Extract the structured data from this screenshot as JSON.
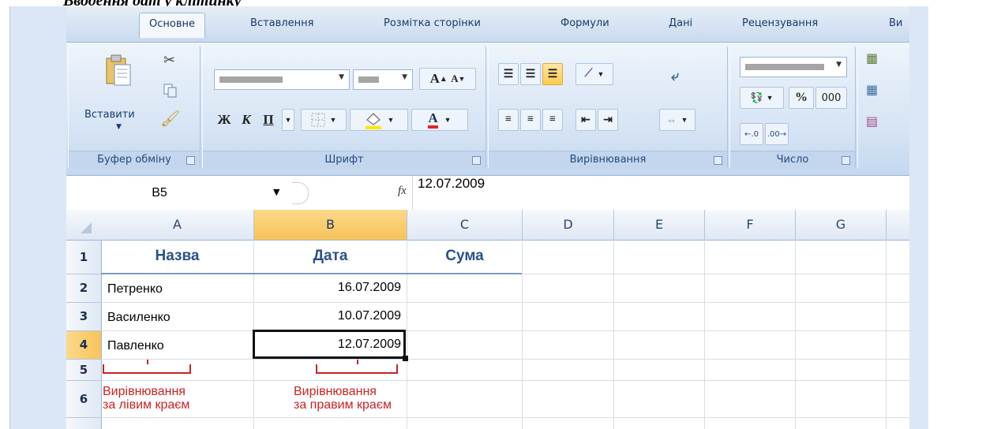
{
  "doc_title": "Вводення дат у клітинку",
  "tabs": [
    "Основне",
    "Вставлення",
    "Розмітка сторінки",
    "Формули",
    "Дані",
    "Рецензування",
    "Ви"
  ],
  "groups": {
    "clipboard": "Буфер обміну",
    "font": "Шрифт",
    "alignment": "Вирівнювання",
    "number": "Число"
  },
  "buttons": {
    "paste": "Вставити",
    "bold": "Ж",
    "italic": "К",
    "underline": "П",
    "grow_font": "A",
    "shrink_font": "A",
    "font_color": "A",
    "percent": "%",
    "thousands": "000"
  },
  "formula_bar": {
    "name_box": "B5",
    "fx": "fx",
    "value": "12.07.2009"
  },
  "columns": [
    "A",
    "B",
    "C",
    "D",
    "E",
    "F",
    "G"
  ],
  "rows": [
    "1",
    "2",
    "3",
    "4",
    "5",
    "6"
  ],
  "cells": {
    "A1": "Назва",
    "B1": "Дата",
    "C1": "Сума",
    "A2": "Петренко",
    "B2": "16.07.2009",
    "A3": "Василенко",
    "B3": "10.07.2009",
    "A4": "Павленко",
    "B4": "12.07.2009"
  },
  "annotations": {
    "left_line1": "Вирівнювання",
    "left_line2": "за лівим краєм",
    "right_line1": "Вирівнювання",
    "right_line2": "за правим краєм"
  },
  "colors": {
    "selected_header": "#f7c35a",
    "annotation": "#cc2222",
    "header_text": "#2a4f8a"
  }
}
